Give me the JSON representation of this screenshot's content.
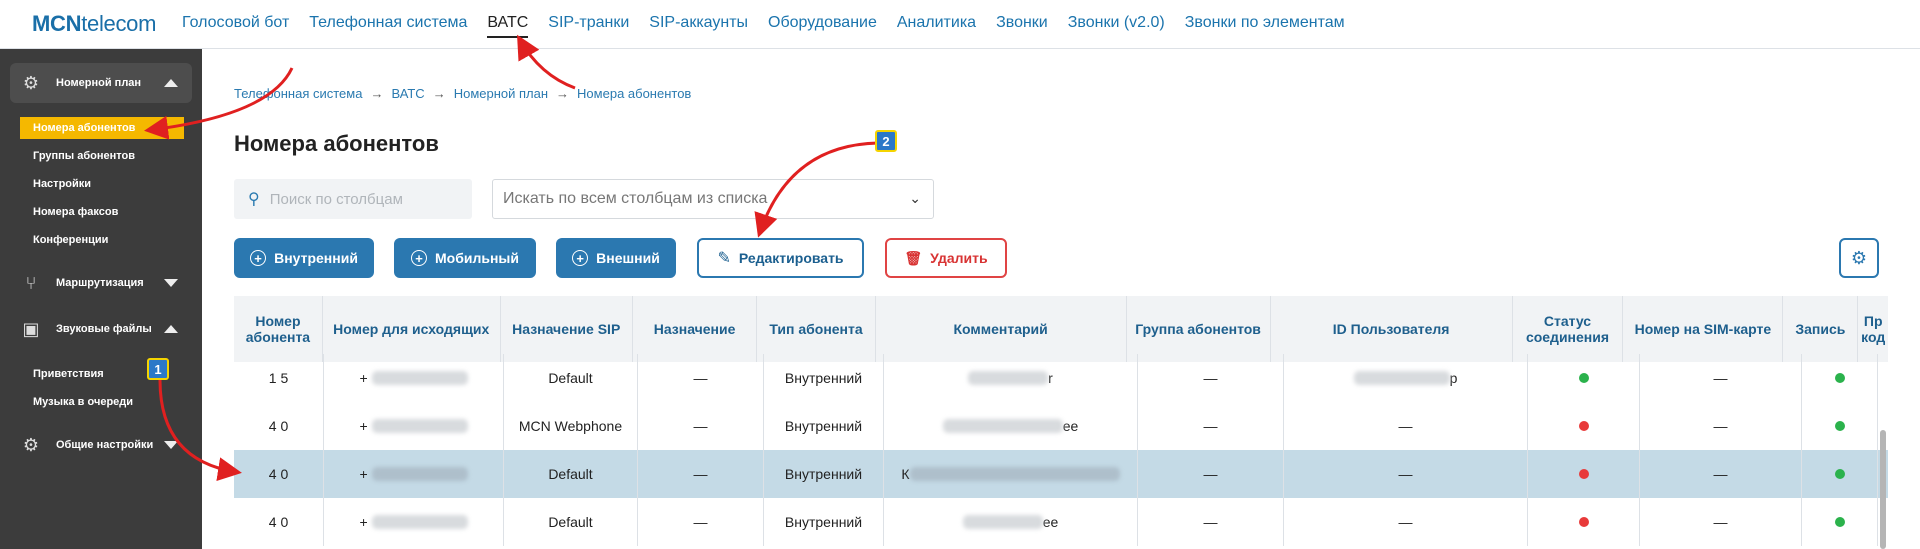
{
  "logo": {
    "part1": "MCN",
    "part2": "telecom"
  },
  "topnav": [
    {
      "label": "Голосовой бот",
      "active": false
    },
    {
      "label": "Телефонная система",
      "active": false
    },
    {
      "label": "ВАТС",
      "active": true
    },
    {
      "label": "SIP-транки",
      "active": false
    },
    {
      "label": "SIP-аккаунты",
      "active": false
    },
    {
      "label": "Оборудование",
      "active": false
    },
    {
      "label": "Аналитика",
      "active": false
    },
    {
      "label": "Звонки",
      "active": false
    },
    {
      "label": "Звонки (v2.0)",
      "active": false
    },
    {
      "label": "Звонки по элементам",
      "active": false
    }
  ],
  "sidebar": {
    "groups": [
      {
        "label": "Номерной план",
        "icon": "gear-icon",
        "open": true
      },
      {
        "label": "Маршрутизация",
        "icon": "routing-icon",
        "open": false
      },
      {
        "label": "Звуковые файлы",
        "icon": "sound-file-icon",
        "open": true
      },
      {
        "label": "Общие настройки",
        "icon": "gear-icon",
        "open": false
      }
    ],
    "numbering_items": [
      "Номера абонентов",
      "Группы абонентов",
      "Настройки",
      "Номера факсов",
      "Конференции"
    ],
    "sound_items": [
      "Приветствия",
      "Музыка в очереди"
    ]
  },
  "breadcrumb": [
    "Телефонная система",
    "ВАТС",
    "Номерной план",
    "Номера абонентов"
  ],
  "page_title": "Номера абонентов",
  "search": {
    "placeholder": "Поиск по столбцам"
  },
  "column_select": {
    "value": "Искать по всем столбцам из списка"
  },
  "buttons": {
    "internal": "Внутренний",
    "mobile": "Мобильный",
    "external": "Внешний",
    "edit": "Редактировать",
    "delete": "Удалить"
  },
  "table": {
    "headers": [
      "Номер абонента",
      "Номер для исходящих",
      "Назначение SIP",
      "Назначение",
      "Тип абонента",
      "Комментарий",
      "Группа абонентов",
      "ID Пользователя",
      "Статус соединения",
      "Номер на SIM-карте",
      "Запись",
      "Пр код"
    ],
    "rows": [
      {
        "number": "1 5",
        "outgoing": "+",
        "sip": "Default",
        "dest": "—",
        "type": "Внутренний",
        "comment": "r",
        "group": "—",
        "user_id": "p",
        "status": "#2bb24c",
        "sim": "—",
        "record": "#2bb24c",
        "selected": false
      },
      {
        "number": "4 0",
        "outgoing": "+",
        "sip": "MCN Webphone",
        "dest": "—",
        "type": "Внутренний",
        "comment": "ee",
        "group": "—",
        "user_id": "—",
        "status": "#e83a3a",
        "sim": "—",
        "record": "#2bb24c",
        "selected": false
      },
      {
        "number": "4 0",
        "outgoing": "+",
        "sip": "Default",
        "dest": "—",
        "type": "Внутренний",
        "comment": "К",
        "group": "—",
        "user_id": "—",
        "status": "#e83a3a",
        "sim": "—",
        "record": "#2bb24c",
        "selected": true
      },
      {
        "number": "4 0",
        "outgoing": "+",
        "sip": "Default",
        "dest": "—",
        "type": "Внутренний",
        "comment": "ee",
        "group": "—",
        "user_id": "—",
        "status": "#e83a3a",
        "sim": "—",
        "record": "#2bb24c",
        "selected": false
      }
    ]
  },
  "annotations": {
    "badge1": "1",
    "badge2": "2"
  },
  "colors": {
    "accent": "#2b78b0",
    "sidebar_active": "#f5b800",
    "arrow": "#e02020"
  }
}
